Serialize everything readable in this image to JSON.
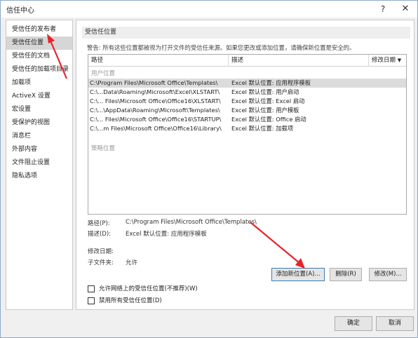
{
  "window": {
    "title": "信任中心",
    "help_icon": "?",
    "close_icon": "✕"
  },
  "sidebar": {
    "items": [
      {
        "label": "受信任的发布者"
      },
      {
        "label": "受信任位置"
      },
      {
        "label": "受信任的文档"
      },
      {
        "label": "受信任的加载项目录"
      },
      {
        "label": "加载项"
      },
      {
        "label": "ActiveX 设置"
      },
      {
        "label": "宏设置"
      },
      {
        "label": "受保护的视图"
      },
      {
        "label": "消息栏"
      },
      {
        "label": "外部内容"
      },
      {
        "label": "文件阻止设置"
      },
      {
        "label": "隐私选项"
      }
    ],
    "active_index": 1
  },
  "main": {
    "section_title": "受信任位置",
    "warning": "警告: 所有这些位置都被视为打开文件的受信任来源。如果您更改或添加位置，请确保新位置是安全的。",
    "columns": {
      "path": "路径",
      "desc": "描述",
      "modified": "修改日期",
      "sort_icon": "▼"
    },
    "user_group_label": "用户位置",
    "policy_group_label": "策略位置",
    "rows": [
      {
        "path": "C:\\Program Files\\Microsoft Office\\Templates\\",
        "desc": "Excel 默认位置: 应用程序模板"
      },
      {
        "path": "C:\\...Data\\Roaming\\Microsoft\\Excel\\XLSTART\\",
        "desc": "Excel 默认位置: 用户启动"
      },
      {
        "path": "C:\\... Files\\Microsoft Office\\Office16\\XLSTART\\",
        "desc": "Excel 默认位置: Excel 启动"
      },
      {
        "path": "C:\\...\\AppData\\Roaming\\Microsoft\\Templates\\",
        "desc": "Excel 默认位置: 用户模板"
      },
      {
        "path": "C:\\... Files\\Microsoft Office\\Office16\\STARTUP\\",
        "desc": "Excel 默认位置: Office 启动"
      },
      {
        "path": "C:\\...m Files\\Microsoft Office\\Office16\\Library\\",
        "desc": "Excel 默认位置: 加载项"
      }
    ],
    "details": {
      "path_label": "路径(P):",
      "path_value": "C:\\Program Files\\Microsoft Office\\Templates\\",
      "desc_label": "描述(D):",
      "desc_value": "Excel 默认位置: 应用程序模板",
      "modified_label": "修改日期:",
      "subfolder_label": "子文件夹:",
      "subfolder_value": "允许"
    },
    "buttons": {
      "add": "添加新位置(A)...",
      "remove": "删除(R)",
      "modify": "修改(M)..."
    },
    "checkboxes": {
      "allow_network": "允许网络上的受信任位置(不推荐)(W)",
      "disable_all": "禁用所有受信任位置(D)"
    }
  },
  "footer": {
    "ok": "确定",
    "cancel": "取消"
  },
  "colors": {
    "annotation_arrow": "#e8232a",
    "selected_bg": "#d6d6d6"
  }
}
